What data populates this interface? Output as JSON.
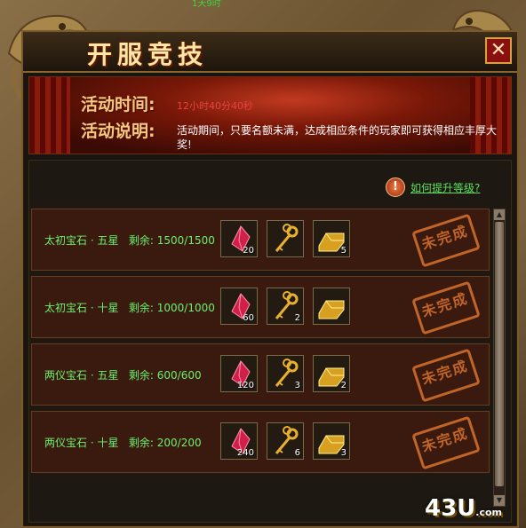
{
  "top_status": "1天9时",
  "window": {
    "title": "开服竞技",
    "close_glyph": "✕"
  },
  "banner": {
    "time_label": "活动时间:",
    "time_value": "12小时40分40秒",
    "desc_label": "活动说明:",
    "desc_text": "活动期间，只要名额未满，达成相应条件的玩家即可获得相应丰厚大奖!"
  },
  "help": {
    "icon": "!",
    "text": "如何提升等级?"
  },
  "rows": [
    {
      "label": "太初宝石 · 五星",
      "remain": "剩余: 1500/1500",
      "gem_count": "20",
      "key_count": "",
      "gold_count": "5",
      "status": "未完成"
    },
    {
      "label": "太初宝石 · 十星",
      "remain": "剩余: 1000/1000",
      "gem_count": "60",
      "key_count": "2",
      "gold_count": "",
      "status": "未完成"
    },
    {
      "label": "两仪宝石 · 五星",
      "remain": "剩余: 600/600",
      "gem_count": "120",
      "key_count": "3",
      "gold_count": "2",
      "status": "未完成"
    },
    {
      "label": "两仪宝石 · 十星",
      "remain": "剩余: 200/200",
      "gem_count": "240",
      "key_count": "6",
      "gold_count": "3",
      "status": "未完成"
    }
  ],
  "scrollbar": {
    "up": "▲",
    "down": "▼"
  },
  "logo": {
    "main": "43U",
    "suffix": ".com"
  },
  "icons": {
    "reward_1": "red-gem-icon",
    "reward_2": "golden-key-icon",
    "reward_3": "gold-bar-icon"
  },
  "colors": {
    "title_gold": "#fbe7a8",
    "label_green": "#6cf06c",
    "stamp_orange": "#c8682a",
    "time_red": "#e84040"
  }
}
